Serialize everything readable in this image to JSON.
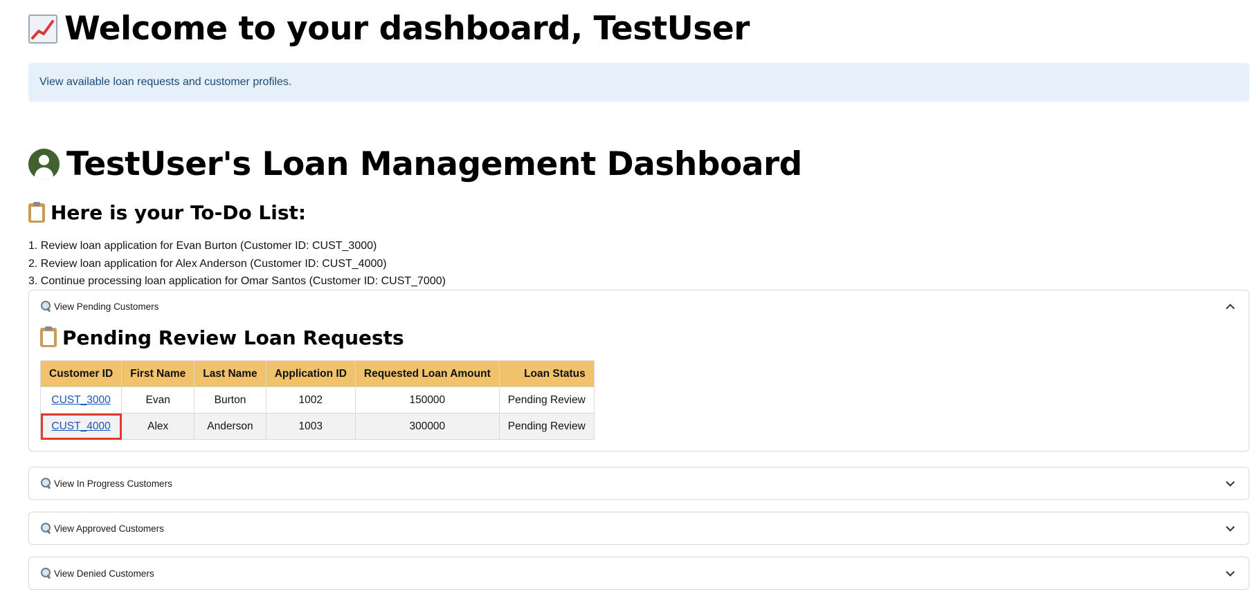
{
  "header": {
    "welcome_title": "Welcome to your dashboard, TestUser",
    "info_text": "View available loan requests and customer profiles."
  },
  "dashboard": {
    "title": "TestUser's Loan Management Dashboard"
  },
  "todo": {
    "title": "Here is your To-Do List:",
    "items": [
      "1. Review loan application for Evan Burton (Customer ID: CUST_3000)",
      "2. Review loan application for Alex Anderson (Customer ID: CUST_4000)",
      "3. Continue processing loan application for Omar Santos (Customer ID: CUST_7000)"
    ]
  },
  "expanders": {
    "pending": {
      "label": "View Pending Customers",
      "expanded": true,
      "section_title": "Pending Review Loan Requests",
      "columns": [
        "Customer ID",
        "First Name",
        "Last Name",
        "Application ID",
        "Requested Loan Amount",
        "Loan Status"
      ],
      "rows": [
        [
          "CUST_3000",
          "Evan",
          "Burton",
          "1002",
          "150000",
          "Pending Review"
        ],
        [
          "CUST_4000",
          "Alex",
          "Anderson",
          "1003",
          "300000",
          "Pending Review"
        ]
      ]
    },
    "in_progress": {
      "label": "View In Progress Customers",
      "expanded": false
    },
    "approved": {
      "label": "View Approved Customers",
      "expanded": false
    },
    "denied": {
      "label": "View Denied Customers",
      "expanded": false
    }
  },
  "colors": {
    "info_bg": "#e5f0fa",
    "info_text": "#1a4b78",
    "table_header": "#f0c26b",
    "link": "#1a55c2",
    "highlight": "#e03a2c",
    "avatar": "#41622f"
  },
  "icons": {
    "welcome": "chart-increasing-icon",
    "dashboard": "user-avatar-icon",
    "todo": "clipboard-icon",
    "expander": "magnifying-glass-icon"
  }
}
